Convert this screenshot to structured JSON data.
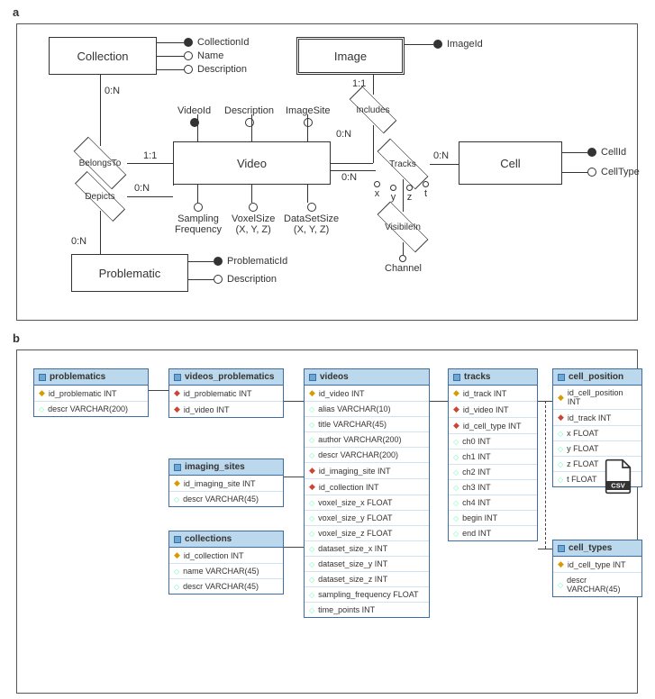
{
  "panels": {
    "a": "a",
    "b": "b"
  },
  "er": {
    "entities": {
      "collection": "Collection",
      "image": "Image",
      "video": "Video",
      "cell": "Cell",
      "problematic": "Problematic"
    },
    "relationships": {
      "belongsTo": "BelongsTo",
      "depicts": "Depicts",
      "includes": "Includes",
      "tracks": "Tracks",
      "visibleIn": "VisibileIn"
    },
    "cardinalities": {
      "collection_video": "0:N",
      "video_belongsTo": "1:1",
      "image_includes": "1:1",
      "video_includes": "0:N",
      "depicts_video": "0:N",
      "problematic_depicts": "0:N",
      "video_tracks": "0:N",
      "cell_tracks": "0:N"
    },
    "attributes": {
      "collection": {
        "collectionId": "CollectionId",
        "name": "Name",
        "description": "Description"
      },
      "image": {
        "imageId": "ImageId"
      },
      "video": {
        "videoId": "VideoId",
        "description": "Description",
        "imageSite": "ImageSite",
        "samplingFrequency": "Sampling\nFrequency",
        "voxelSize": "VoxelSize\n(X, Y, Z)",
        "dataSetSize": "DataSetSize\n(X, Y, Z)"
      },
      "cell": {
        "cellId": "CellId",
        "cellType": "CellType"
      },
      "problematic": {
        "problematicId": "ProblematicId",
        "description": "Description"
      },
      "tracks": {
        "x": "x",
        "y": "y",
        "z": "z",
        "t": "t"
      },
      "visibleIn": {
        "channel": "Channel"
      }
    }
  },
  "schema": {
    "problematics": {
      "name": "problematics",
      "cols": [
        {
          "k": "pk",
          "n": "id_problematic INT"
        },
        {
          "k": "col",
          "n": "descr VARCHAR(200)"
        }
      ]
    },
    "videos_problematics": {
      "name": "videos_problematics",
      "cols": [
        {
          "k": "fk",
          "n": "id_problematic INT"
        },
        {
          "k": "fk",
          "n": "id_video INT"
        }
      ]
    },
    "imaging_sites": {
      "name": "imaging_sites",
      "cols": [
        {
          "k": "pk",
          "n": "id_imaging_site INT"
        },
        {
          "k": "col",
          "n": "descr VARCHAR(45)"
        }
      ]
    },
    "collections": {
      "name": "collections",
      "cols": [
        {
          "k": "pk",
          "n": "id_collection INT"
        },
        {
          "k": "col",
          "n": "name VARCHAR(45)"
        },
        {
          "k": "col",
          "n": "descr VARCHAR(45)"
        }
      ]
    },
    "videos": {
      "name": "videos",
      "cols": [
        {
          "k": "pk",
          "n": "id_video INT"
        },
        {
          "k": "col",
          "n": "alias VARCHAR(10)"
        },
        {
          "k": "col",
          "n": "title VARCHAR(45)"
        },
        {
          "k": "col",
          "n": "author VARCHAR(200)"
        },
        {
          "k": "col",
          "n": "descr VARCHAR(200)"
        },
        {
          "k": "fk",
          "n": "id_imaging_site INT"
        },
        {
          "k": "fk",
          "n": "id_collection INT"
        },
        {
          "k": "col",
          "n": "voxel_size_x FLOAT"
        },
        {
          "k": "col",
          "n": "voxel_size_y FLOAT"
        },
        {
          "k": "col",
          "n": "voxel_size_z FLOAT"
        },
        {
          "k": "col",
          "n": "dataset_size_x INT"
        },
        {
          "k": "col",
          "n": "dataset_size_y INT"
        },
        {
          "k": "col",
          "n": "dataset_size_z INT"
        },
        {
          "k": "col",
          "n": "sampling_frequency FLOAT"
        },
        {
          "k": "col",
          "n": "time_points INT"
        }
      ]
    },
    "tracks": {
      "name": "tracks",
      "cols": [
        {
          "k": "pk",
          "n": "id_track INT"
        },
        {
          "k": "fk",
          "n": "id_video INT"
        },
        {
          "k": "fk",
          "n": "id_cell_type INT"
        },
        {
          "k": "col",
          "n": "ch0 INT"
        },
        {
          "k": "col",
          "n": "ch1 INT"
        },
        {
          "k": "col",
          "n": "ch2 INT"
        },
        {
          "k": "col",
          "n": "ch3 INT"
        },
        {
          "k": "col",
          "n": "ch4 INT"
        },
        {
          "k": "col",
          "n": "begin INT"
        },
        {
          "k": "col",
          "n": "end INT"
        }
      ]
    },
    "cell_position": {
      "name": "cell_position",
      "cols": [
        {
          "k": "pk",
          "n": "id_cell_position INT"
        },
        {
          "k": "fk",
          "n": "id_track INT"
        },
        {
          "k": "col",
          "n": "x FLOAT"
        },
        {
          "k": "col",
          "n": "y FLOAT"
        },
        {
          "k": "col",
          "n": "z FLOAT"
        },
        {
          "k": "col",
          "n": "t FLOAT"
        }
      ]
    },
    "cell_types": {
      "name": "cell_types",
      "cols": [
        {
          "k": "pk",
          "n": "id_cell_type INT"
        },
        {
          "k": "col",
          "n": "descr VARCHAR(45)"
        }
      ]
    }
  },
  "csv_label": "CSV"
}
